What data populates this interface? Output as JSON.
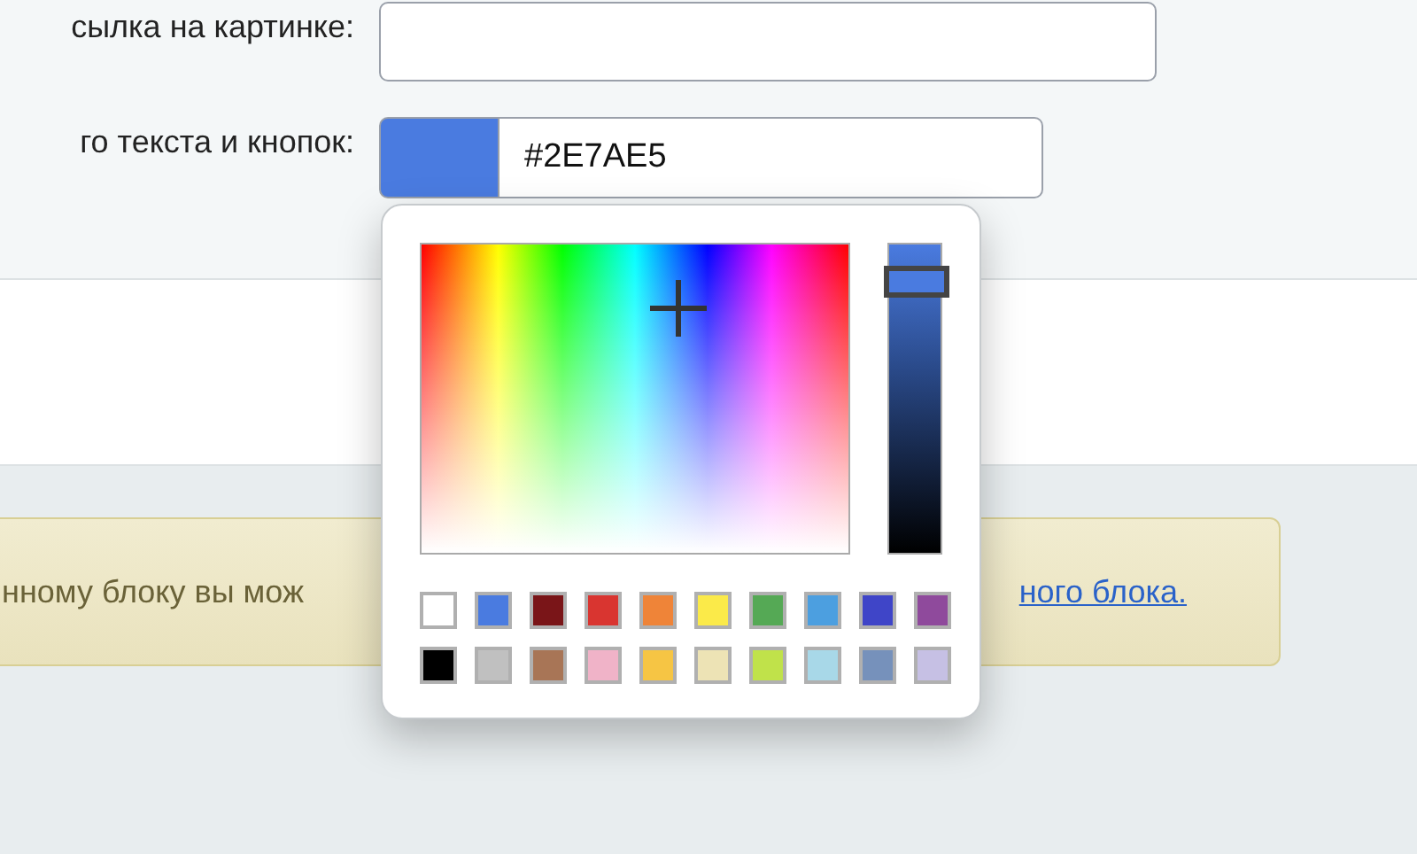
{
  "form": {
    "rows": [
      {
        "label": "сылка на картинке:",
        "kind": "text",
        "value": ""
      },
      {
        "label": "го текста и кнопок:",
        "kind": "color",
        "color": "#4a7be0",
        "value": "#2E7AE5"
      }
    ]
  },
  "color_picker": {
    "brightness": {
      "level": 0.9
    },
    "swatches": [
      {
        "color": "#ffffff"
      },
      {
        "color": "#4a7be0"
      },
      {
        "color": "#7a1518"
      },
      {
        "color": "#d93530"
      },
      {
        "color": "#ef8438"
      },
      {
        "color": "#fbea49"
      },
      {
        "color": "#55a955"
      },
      {
        "color": "#4c9fe0"
      },
      {
        "color": "#3f45c8"
      },
      {
        "color": "#8f4a9c"
      },
      {
        "color": "#000000"
      },
      {
        "color": "#c0c0c0"
      },
      {
        "color": "#a87556"
      },
      {
        "color": "#f0b3c8"
      },
      {
        "color": "#f6c544"
      },
      {
        "color": "#ede3b5"
      },
      {
        "color": "#c0e24a"
      },
      {
        "color": "#a8d8e8"
      },
      {
        "color": "#7691bb"
      },
      {
        "color": "#c6c0e4"
      }
    ]
  },
  "notice": {
    "text": "нному блоку вы мож",
    "link": "ного блока."
  }
}
